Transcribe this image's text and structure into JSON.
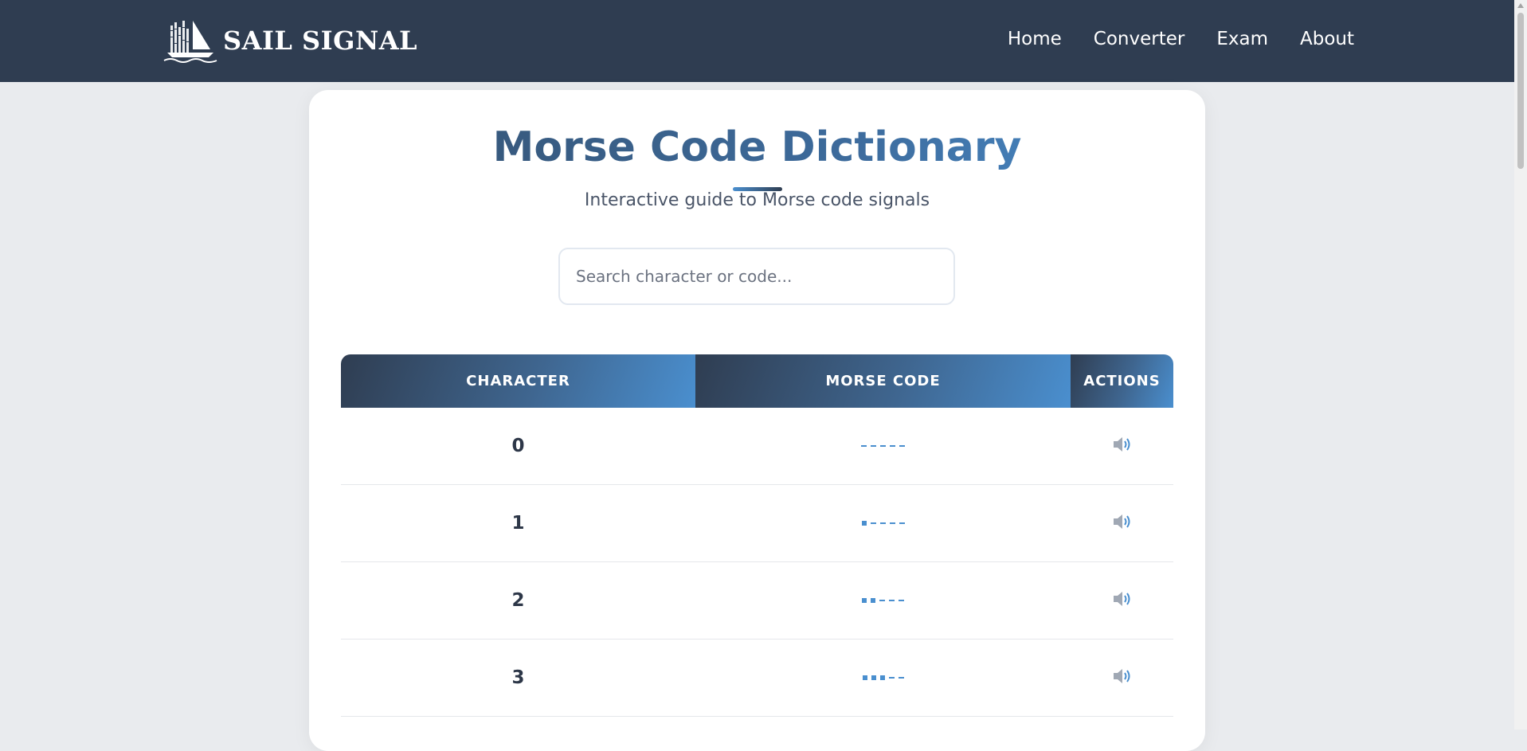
{
  "brand": {
    "name": "SAIL SIGNAL"
  },
  "nav": {
    "links": [
      "Home",
      "Converter",
      "Exam",
      "About"
    ]
  },
  "page": {
    "title": "Morse Code Dictionary",
    "subtitle": "Interactive guide to Morse code signals"
  },
  "search": {
    "placeholder": "Search character or code...",
    "value": ""
  },
  "table": {
    "headers": [
      "CHARACTER",
      "MORSE CODE",
      "ACTIONS"
    ],
    "rows": [
      {
        "character": "0",
        "code": "-----"
      },
      {
        "character": "1",
        "code": ".----"
      },
      {
        "character": "2",
        "code": "..---"
      },
      {
        "character": "3",
        "code": "...--"
      }
    ]
  },
  "icons": {
    "play": "speaker-icon",
    "logo": "sailboat-logo-icon"
  },
  "colors": {
    "navbar": "#2f3d51",
    "accent": "#4a8fcf",
    "background": "#e9ebee"
  }
}
